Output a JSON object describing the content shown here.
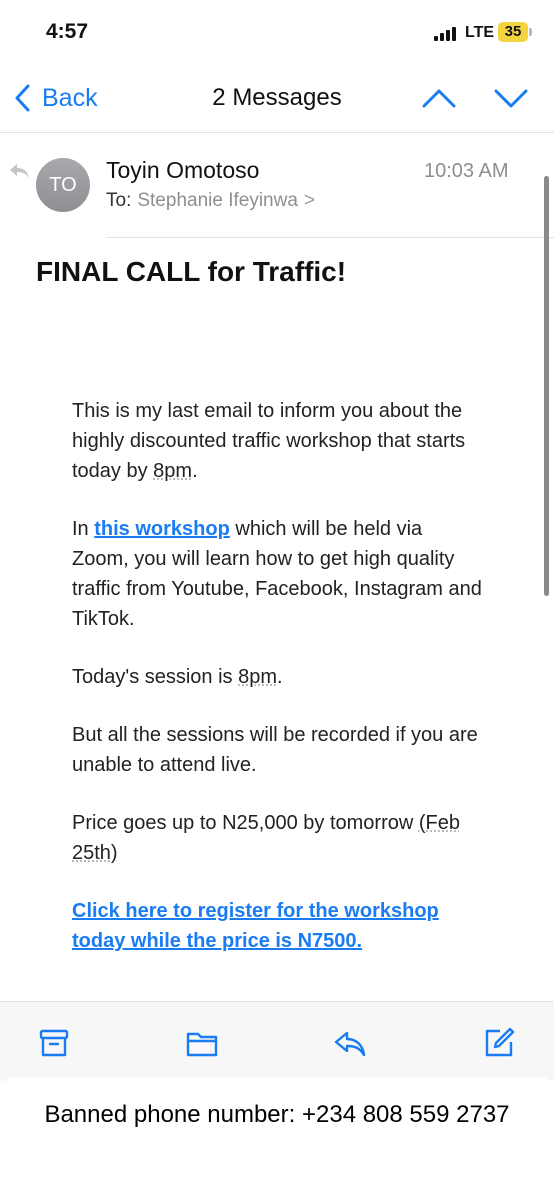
{
  "status_bar": {
    "time": "4:57",
    "network": "LTE",
    "battery": "35"
  },
  "nav": {
    "back_label": "Back",
    "title": "2 Messages"
  },
  "message": {
    "avatar_initials": "TO",
    "sender": "Toyin Omotoso",
    "time": "10:03 AM",
    "to_label": "To:",
    "recipient": "Stephanie Ifeyinwa",
    "recipient_chevron": ">",
    "subject": "FINAL CALL for Traffic!",
    "p1_a": "This is my last email to inform you about the highly discounted traffic workshop that starts today by ",
    "p1_time": "8pm",
    "p1_end": ".",
    "p2_a": "In ",
    "p2_link": "this workshop",
    "p2_b": " which will be held via Zoom, you will learn how to get high quality traffic from Youtube, Facebook, Instagram and TikTok.",
    "p3_a": "Today's session is ",
    "p3_time": "8pm",
    "p3_end": ".",
    "p4": "But all the sessions will be recorded if you are unable to attend live.",
    "p5_a": "Price goes up to N25,000 by tomorrow ",
    "p5_date": "(Feb 25th)",
    "register_link": "Click here to register for the workshop today while the price is N7500."
  },
  "toolbar": {
    "icons": [
      "archive-icon",
      "folder-icon",
      "reply-icon",
      "compose-icon"
    ]
  },
  "banner": {
    "text": "Banned phone number: +234 808 559 2737"
  },
  "colors": {
    "accent": "#1a7cf2",
    "battery": "#f3d43e",
    "secondary_text": "#8e8e93"
  }
}
